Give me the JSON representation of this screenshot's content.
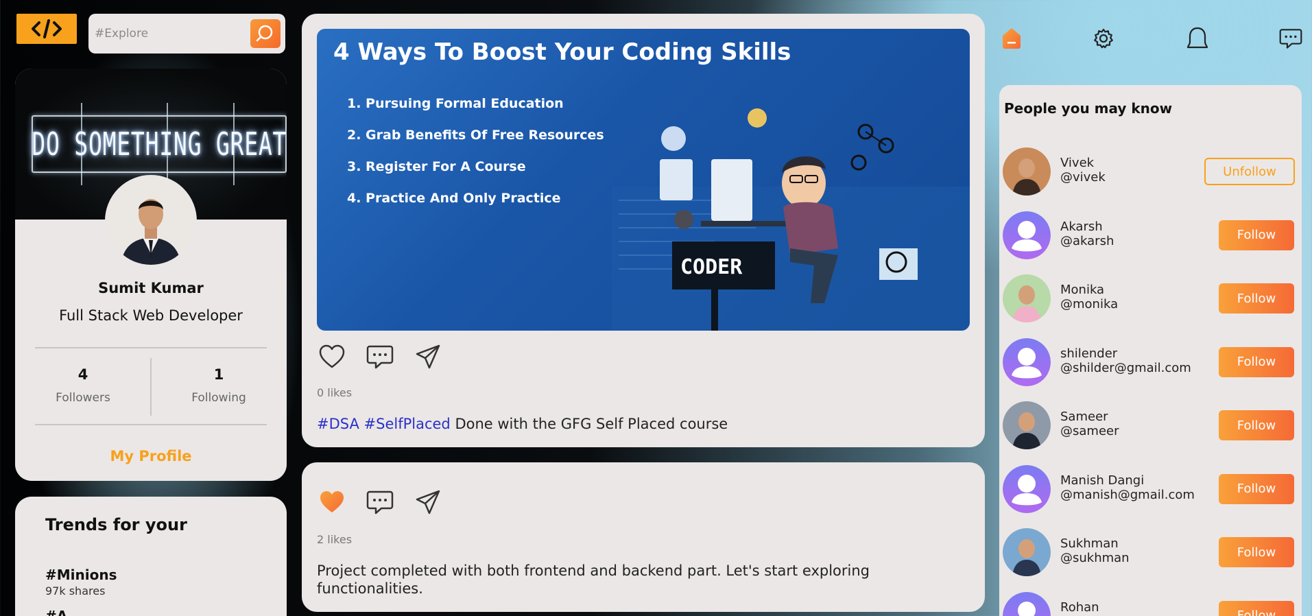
{
  "header": {
    "search_placeholder": "#Explore"
  },
  "profile": {
    "cover_text": "DO SOMETHING GREAT",
    "name": "Sumit Kumar",
    "role": "Full Stack Web Developer",
    "followers_count": "4",
    "followers_label": "Followers",
    "following_count": "1",
    "following_label": "Following",
    "my_profile_label": "My Profile"
  },
  "trends": {
    "title": "Trends for your",
    "items": [
      {
        "tag": "#Minions",
        "shares": "97k shares"
      },
      {
        "tag": "#A",
        "shares": ""
      }
    ]
  },
  "posts": [
    {
      "image": {
        "title": "4 Ways To Boost Your Coding Skills",
        "list": [
          "1.  Pursuing Formal Education",
          "2.  Grab Benefits Of Free Resources",
          "3.  Register For A Course",
          "4.  Practice And Only Practice"
        ],
        "tag": "CODER"
      },
      "likes": "0 likes",
      "liked": false,
      "hashtags": "#DSA #SelfPlaced",
      "caption": " Done with the GFG Self Placed course"
    },
    {
      "likes": "2 likes",
      "liked": true,
      "caption": "Project completed with both frontend and backend part. Let's start exploring functionalities."
    }
  ],
  "people": {
    "title": "People you may know",
    "items": [
      {
        "name": "Vivek",
        "handle": "@vivek",
        "button": "Unfollow",
        "avatar": "photo"
      },
      {
        "name": "Akarsh",
        "handle": "@akarsh",
        "button": "Follow",
        "avatar": "default"
      },
      {
        "name": "Monika",
        "handle": "@monika",
        "button": "Follow",
        "avatar": "photo"
      },
      {
        "name": "shilender",
        "handle": "@shilder@gmail.com",
        "button": "Follow",
        "avatar": "default"
      },
      {
        "name": "Sameer",
        "handle": "@sameer",
        "button": "Follow",
        "avatar": "photo"
      },
      {
        "name": "Manish Dangi",
        "handle": "@manish@gmail.com",
        "button": "Follow",
        "avatar": "default"
      },
      {
        "name": "Sukhman",
        "handle": "@sukhman",
        "button": "Follow",
        "avatar": "photo"
      },
      {
        "name": "Rohan",
        "handle": "",
        "button": "Follow",
        "avatar": "default"
      }
    ]
  },
  "colors": {
    "accent": "#f7a11c",
    "accent_gradient_end": "#f56a36",
    "card_bg": "#ebe7e6",
    "hashtag": "#2a31c9",
    "avatar_default": "#8b6cf0"
  },
  "icons": [
    "code-logo-icon",
    "search-icon",
    "home-icon",
    "gear-icon",
    "bell-icon",
    "chat-icon",
    "heart-icon",
    "comment-icon",
    "send-icon"
  ]
}
